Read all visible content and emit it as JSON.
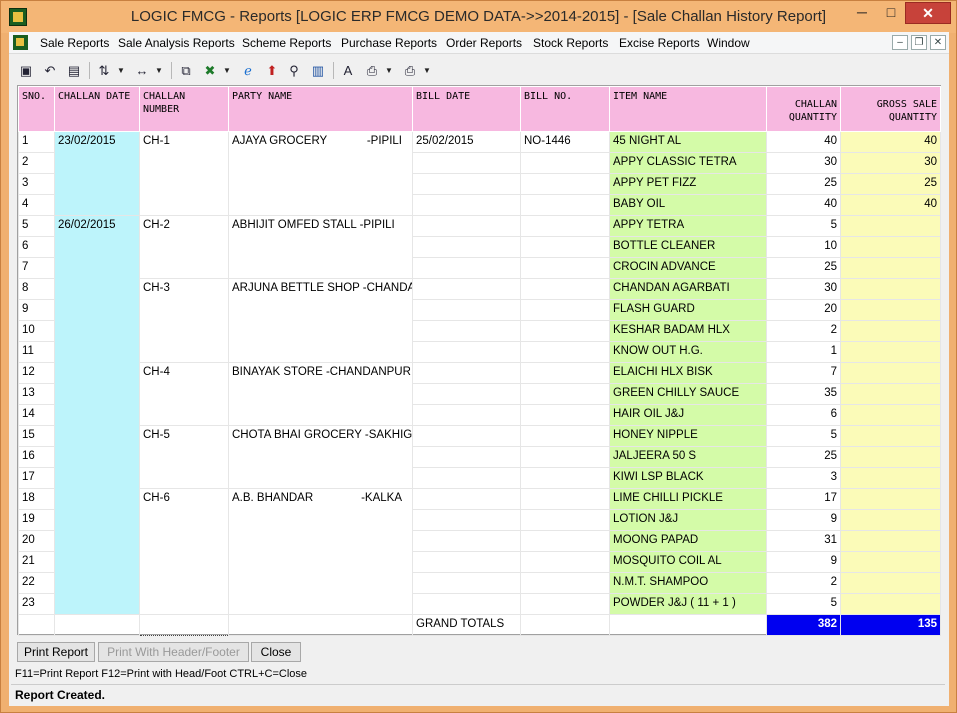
{
  "window": {
    "title": "LOGIC FMCG - Reports  [LOGIC ERP FMCG DEMO DATA->>2014-2015] - [Sale Challan History Report]",
    "minimize": "─",
    "maximize": "□",
    "close": "✕"
  },
  "menu": [
    "Sale Reports",
    "Sale Analysis Reports",
    "Scheme Reports",
    "Purchase Reports",
    "Order Reports",
    "Stock Reports",
    "Excise Reports",
    "Window"
  ],
  "mdi": {
    "minimize": "–",
    "restore": "❐",
    "close": "✕"
  },
  "columns": {
    "sno": "SNO.",
    "challan_date": "CHALLAN DATE",
    "challan_number": "CHALLAN NUMBER",
    "party_name": "PARTY NAME",
    "bill_date": "BILL DATE",
    "bill_no": "BILL NO.",
    "item_name": "ITEM NAME",
    "challan_qty": "CHALLAN QUANTITY",
    "gross_sale_qty": "GROSS SALE QUANTITY"
  },
  "groups": [
    {
      "date": "23/02/2015",
      "challan": "CH-1",
      "party": "AJAYA GROCERY",
      "party_loc": "-PIPILI",
      "bill_date": "25/02/2015",
      "bill_no": "NO-1446",
      "rows": 4
    },
    {
      "date": "26/02/2015",
      "challan": "CH-2",
      "party": "ABHIJIT OMFED STALL -PIPILI",
      "party_loc": "",
      "bill_date": "",
      "bill_no": "",
      "rows": 3
    },
    {
      "date": "",
      "challan": "CH-3",
      "party": "ARJUNA BETTLE SHOP -CHANDANPUR",
      "party_loc": "",
      "bill_date": "",
      "bill_no": "",
      "rows": 4
    },
    {
      "date": "",
      "challan": "CH-4",
      "party": "BINAYAK STORE -CHANDANPUR",
      "party_loc": "",
      "bill_date": "",
      "bill_no": "",
      "rows": 3
    },
    {
      "date": "",
      "challan": "CH-5",
      "party": "CHOTA BHAI GROCERY -SAKHIGOPAL",
      "party_loc": "",
      "bill_date": "",
      "bill_no": "",
      "rows": 3
    },
    {
      "date": "",
      "challan": "CH-6",
      "party": "A.B. BHANDAR",
      "party_loc": "-KALKA",
      "bill_date": "",
      "bill_no": "",
      "rows": 6
    }
  ],
  "rows": [
    {
      "sno": "1",
      "item": "45 NIGHT AL",
      "cq": "40",
      "gq": "40"
    },
    {
      "sno": "2",
      "item": "APPY CLASSIC TETRA",
      "cq": "30",
      "gq": "30"
    },
    {
      "sno": "3",
      "item": "APPY PET FIZZ",
      "cq": "25",
      "gq": "25"
    },
    {
      "sno": "4",
      "item": "BABY OIL",
      "cq": "40",
      "gq": "40"
    },
    {
      "sno": "5",
      "item": "APPY TETRA",
      "cq": "5",
      "gq": ""
    },
    {
      "sno": "6",
      "item": "BOTTLE CLEANER",
      "cq": "10",
      "gq": ""
    },
    {
      "sno": "7",
      "item": "CROCIN ADVANCE",
      "cq": "25",
      "gq": ""
    },
    {
      "sno": "8",
      "item": "CHANDAN AGARBATI",
      "cq": "30",
      "gq": ""
    },
    {
      "sno": "9",
      "item": "FLASH GUARD",
      "cq": "20",
      "gq": ""
    },
    {
      "sno": "10",
      "item": "KESHAR BADAM HLX",
      "cq": "2",
      "gq": ""
    },
    {
      "sno": "11",
      "item": "KNOW OUT H.G.",
      "cq": "1",
      "gq": ""
    },
    {
      "sno": "12",
      "item": "ELAICHI HLX BISK",
      "cq": "7",
      "gq": ""
    },
    {
      "sno": "13",
      "item": "GREEN CHILLY SAUCE",
      "cq": "35",
      "gq": ""
    },
    {
      "sno": "14",
      "item": "HAIR OIL J&J",
      "cq": "6",
      "gq": ""
    },
    {
      "sno": "15",
      "item": "HONEY NIPPLE",
      "cq": "5",
      "gq": ""
    },
    {
      "sno": "16",
      "item": "JALJEERA 50 S",
      "cq": "25",
      "gq": ""
    },
    {
      "sno": "17",
      "item": "KIWI LSP BLACK",
      "cq": "3",
      "gq": ""
    },
    {
      "sno": "18",
      "item": "LIME CHILLI PICKLE",
      "cq": "17",
      "gq": ""
    },
    {
      "sno": "19",
      "item": "LOTION J&J",
      "cq": "9",
      "gq": ""
    },
    {
      "sno": "20",
      "item": "MOONG PAPAD",
      "cq": "31",
      "gq": ""
    },
    {
      "sno": "21",
      "item": "MOSQUITO COIL AL",
      "cq": "9",
      "gq": ""
    },
    {
      "sno": "22",
      "item": "N.M.T. SHAMPOO",
      "cq": "2",
      "gq": ""
    },
    {
      "sno": "23",
      "item": "POWDER J&J ( 11 + 1 )",
      "cq": "5",
      "gq": ""
    }
  ],
  "totals": {
    "label": "GRAND TOTALS",
    "challan_qty": "382",
    "gross_sale_qty": "135"
  },
  "buttons": {
    "print_report": "Print Report",
    "print_header_footer": "Print With Header/Footer",
    "close": "Close"
  },
  "hint": "F11=Print Report  F12=Print with Head/Foot  CTRL+C=Close",
  "status": "Report Created.",
  "colors": {
    "header": "#f7b8e0",
    "date_col": "#bdf4fb",
    "item_col": "#d4fba8",
    "gross_col": "#fbfbb8",
    "totals": "#0000f0"
  }
}
